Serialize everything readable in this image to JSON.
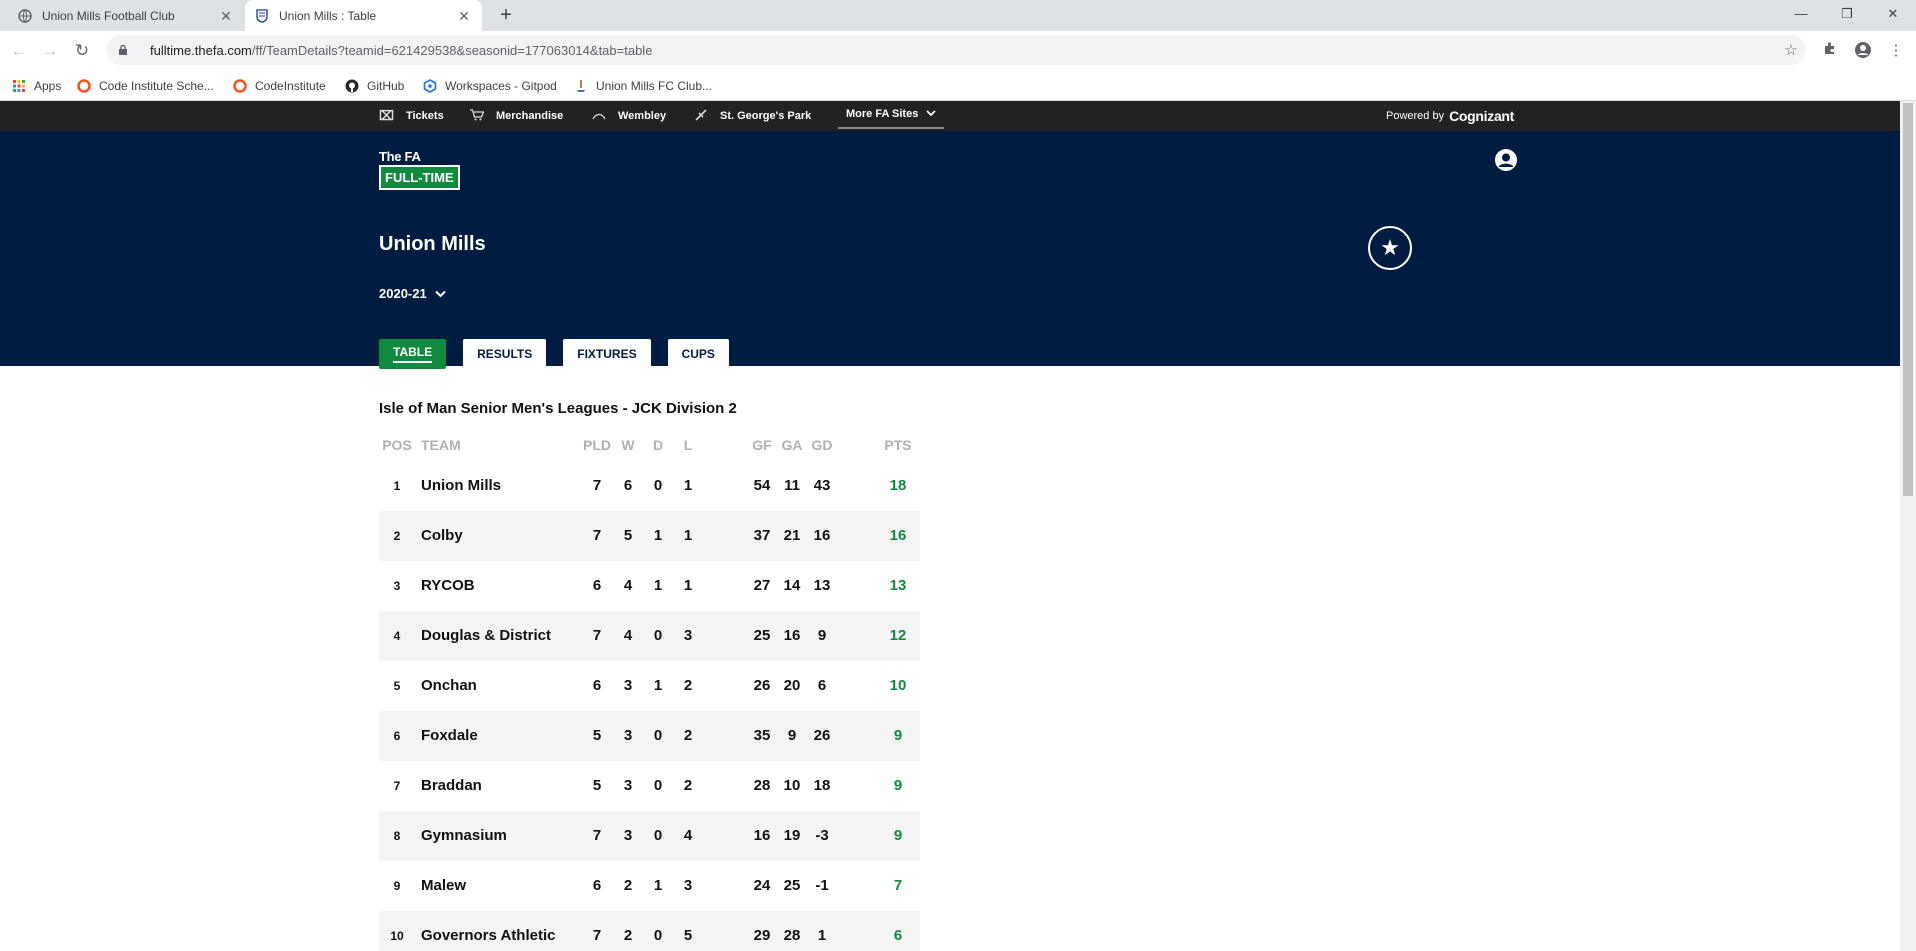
{
  "browser": {
    "tabs": [
      {
        "title": "Union Mills Football Club"
      },
      {
        "title": "Union Mills : Table"
      }
    ],
    "url_host": "fulltime.thefa.com",
    "url_path": "/ff/TeamDetails?teamid=621429538&seasonid=177063014&tab=table",
    "bookmarks": [
      {
        "label": "Apps",
        "icon": "apps-grid-icon"
      },
      {
        "label": "Code Institute Sche...",
        "icon": "code-institute-icon"
      },
      {
        "label": "CodeInstitute",
        "icon": "code-institute-icon"
      },
      {
        "label": "GitHub",
        "icon": "github-icon"
      },
      {
        "label": "Workspaces - Gitpod",
        "icon": "gitpod-icon"
      },
      {
        "label": "Union Mills FC Club...",
        "icon": "union-mills-icon"
      }
    ]
  },
  "topbar": {
    "links": [
      {
        "label": "Tickets",
        "icon": "ticket-icon"
      },
      {
        "label": "Merchandise",
        "icon": "cart-icon"
      },
      {
        "label": "Wembley",
        "icon": "stadium-icon"
      },
      {
        "label": "St. George's Park",
        "icon": "park-icon"
      },
      {
        "label": "More FA Sites"
      }
    ],
    "powered_by": "Powered by",
    "sponsor": "Cognizant"
  },
  "hero": {
    "logo_top": "The FA",
    "logo_bottom": "FULL-TIME",
    "team_name": "Union Mills",
    "season": "2020-21",
    "tabs": [
      "TABLE",
      "RESULTS",
      "FIXTURES",
      "CUPS"
    ],
    "active_tab": "TABLE"
  },
  "league": {
    "title": "Isle of Man Senior Men's Leagues - JCK Division 2",
    "headers": {
      "pos": "POS",
      "team": "TEAM",
      "pld": "PLD",
      "w": "W",
      "d": "D",
      "l": "L",
      "gf": "GF",
      "ga": "GA",
      "gd": "GD",
      "pts": "PTS"
    },
    "rows": [
      {
        "pos": "1",
        "team": "Union Mills",
        "pld": "7",
        "w": "6",
        "d": "0",
        "l": "1",
        "gf": "54",
        "ga": "11",
        "gd": "43",
        "pts": "18"
      },
      {
        "pos": "2",
        "team": "Colby",
        "pld": "7",
        "w": "5",
        "d": "1",
        "l": "1",
        "gf": "37",
        "ga": "21",
        "gd": "16",
        "pts": "16"
      },
      {
        "pos": "3",
        "team": "RYCOB",
        "pld": "6",
        "w": "4",
        "d": "1",
        "l": "1",
        "gf": "27",
        "ga": "14",
        "gd": "13",
        "pts": "13"
      },
      {
        "pos": "4",
        "team": "Douglas & District",
        "pld": "7",
        "w": "4",
        "d": "0",
        "l": "3",
        "gf": "25",
        "ga": "16",
        "gd": "9",
        "pts": "12"
      },
      {
        "pos": "5",
        "team": "Onchan",
        "pld": "6",
        "w": "3",
        "d": "1",
        "l": "2",
        "gf": "26",
        "ga": "20",
        "gd": "6",
        "pts": "10"
      },
      {
        "pos": "6",
        "team": "Foxdale",
        "pld": "5",
        "w": "3",
        "d": "0",
        "l": "2",
        "gf": "35",
        "ga": "9",
        "gd": "26",
        "pts": "9"
      },
      {
        "pos": "7",
        "team": "Braddan",
        "pld": "5",
        "w": "3",
        "d": "0",
        "l": "2",
        "gf": "28",
        "ga": "10",
        "gd": "18",
        "pts": "9"
      },
      {
        "pos": "8",
        "team": "Gymnasium",
        "pld": "7",
        "w": "3",
        "d": "0",
        "l": "4",
        "gf": "16",
        "ga": "19",
        "gd": "-3",
        "pts": "9"
      },
      {
        "pos": "9",
        "team": "Malew",
        "pld": "6",
        "w": "2",
        "d": "1",
        "l": "3",
        "gf": "24",
        "ga": "25",
        "gd": "-1",
        "pts": "7"
      },
      {
        "pos": "10",
        "team": "Governors Athletic",
        "pld": "7",
        "w": "2",
        "d": "0",
        "l": "5",
        "gf": "29",
        "ga": "28",
        "gd": "1",
        "pts": "6"
      }
    ]
  },
  "colors": {
    "navy": "#001c41",
    "green": "#0f8a3f",
    "topbar": "#222222"
  }
}
